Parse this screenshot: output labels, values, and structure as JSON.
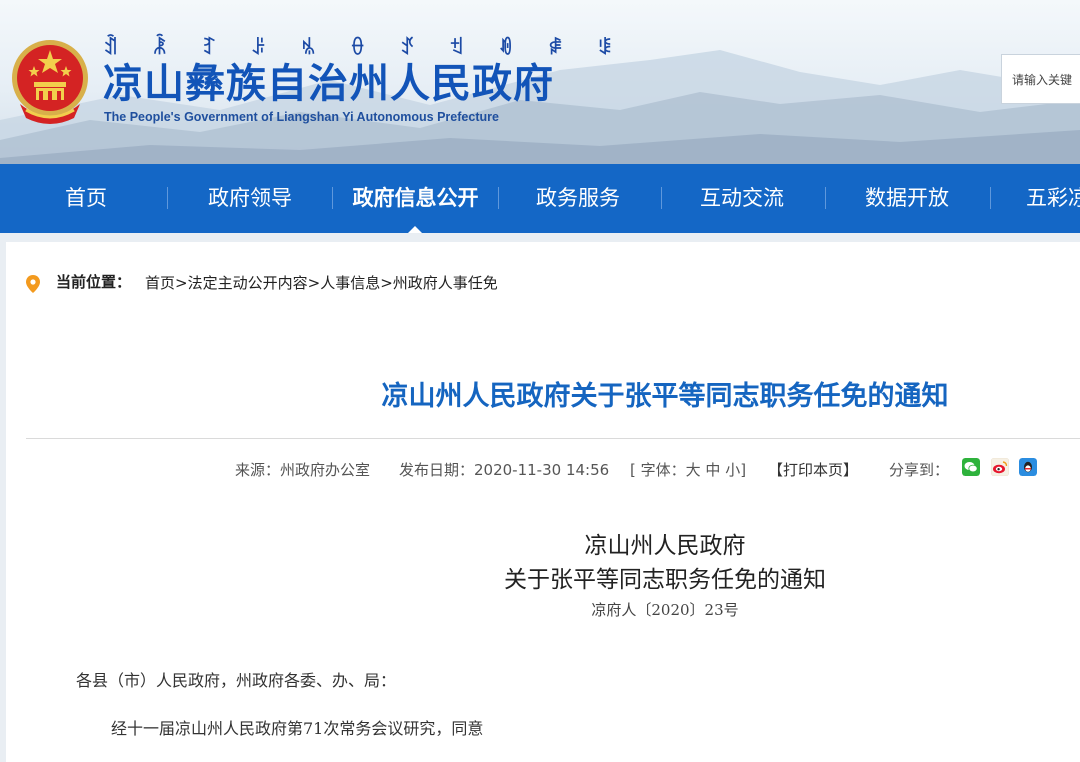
{
  "header": {
    "yi_script": "ꀉ ꂾ ꆈ ꌠ ꁱ ꂷ ꀋ ꉬ ꀑ ꍂ ꌐ",
    "title": "凉山彝族自治州人民政府",
    "subtitle": "The People's Government of Liangshan Yi Autonomous Prefecture",
    "search_placeholder": "请输入关键"
  },
  "nav": {
    "items": [
      {
        "label": "首页"
      },
      {
        "label": "政府领导"
      },
      {
        "label": "政府信息公开"
      },
      {
        "label": "政务服务"
      },
      {
        "label": "互动交流"
      },
      {
        "label": "数据开放"
      },
      {
        "label": "五彩凉"
      }
    ]
  },
  "breadcrumb": {
    "label": "当前位置：",
    "items": [
      "首页",
      "法定主动公开内容",
      "人事信息",
      "州政府人事任免"
    ],
    "sep": ">"
  },
  "article": {
    "title": "凉山州人民政府关于张平等同志职务任免的通知",
    "meta": {
      "source": "来源：州政府办公室",
      "date": "发布日期：2020-11-30 14:56",
      "font_open": "[ 字体：",
      "font_large": "大",
      "font_medium": "中",
      "font_small": "小",
      "font_close": "]",
      "print": "【打印本页】",
      "share": "分享到："
    },
    "doc_title_1": "凉山州人民政府",
    "doc_title_2": "关于张平等同志职务任免的通知",
    "doc_number": "凉府人〔2020〕23号",
    "salutation": "各县（市）人民政府，州政府各委、办、局：",
    "body_start": "经十一届凉山州人民政府第71次常务会议研究，同意"
  },
  "colors": {
    "nav_bg": "#1467c6",
    "title_blue": "#1565c0",
    "brand_blue": "#1254b8",
    "location_pin": "#f39a1e"
  }
}
